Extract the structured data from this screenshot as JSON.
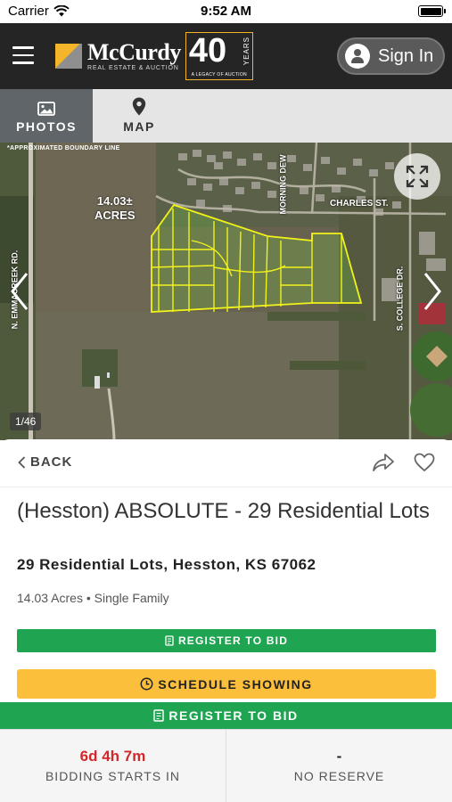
{
  "status_bar": {
    "carrier": "Carrier",
    "time": "9:52 AM"
  },
  "header": {
    "logo_name": "McCurdy",
    "logo_sub": "REAL ESTATE & AUCTION",
    "logo_anniversary": "40",
    "logo_years": "YEARS",
    "logo_tagline": "A LEGACY OF AUCTION",
    "sign_in_label": "Sign In"
  },
  "tabs": [
    {
      "label": "PHOTOS",
      "icon": "image-icon",
      "active": true
    },
    {
      "label": "MAP",
      "icon": "map-pin-icon",
      "active": false
    }
  ],
  "photo": {
    "boundary_note": "*APPROXIMATED BOUNDARY LINE",
    "acreage_label_line1": "14.03±",
    "acreage_label_line2": "ACRES",
    "road_labels": {
      "west": "N. EMMACREEK RD.",
      "morning_dew": "MORNING DEW",
      "charles": "CHARLES ST.",
      "college": "S. COLLEGE DR."
    },
    "counter": "1/46"
  },
  "detail": {
    "back_label": "BACK",
    "title": "(Hesston) ABSOLUTE - 29 Residential Lots",
    "address": "29 Residential Lots, Hesston, KS 67062",
    "meta": "14.03 Acres • Single Family",
    "register_label": "REGISTER TO BID",
    "schedule_label": "SCHEDULE SHOWING"
  },
  "sticky": {
    "register_label": "REGISTER TO BID",
    "countdown": "6d 4h 7m",
    "countdown_label": "BIDDING STARTS IN",
    "reserve_value": "-",
    "reserve_label": "NO RESERVE"
  },
  "colors": {
    "header_bg": "#252525",
    "accent_gold": "#f4b52a",
    "green": "#1fa552",
    "schedule_yellow": "#fbbf3b",
    "countdown_red": "#d0282b",
    "boundary_yellow": "#f2f21a"
  }
}
